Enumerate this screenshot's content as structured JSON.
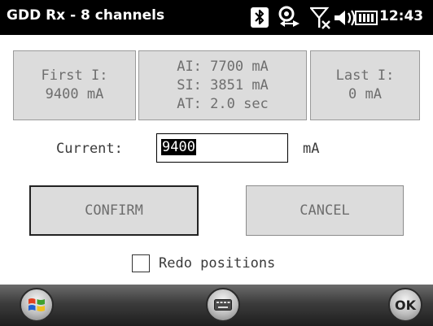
{
  "statusbar": {
    "title": "GDD Rx - 8 channels",
    "time": "12:43",
    "icons": [
      "bluetooth-icon",
      "network-sync-icon",
      "no-signal-icon",
      "volume-icon",
      "battery-icon"
    ]
  },
  "info": {
    "first_line1": "First I:",
    "first_line2": "9400 mA",
    "mid_line1": "AI: 7700 mA",
    "mid_line2": "SI: 3851 mA",
    "mid_line3": "AT: 2.0 sec",
    "last_line1": "Last I:",
    "last_line2": "0 mA"
  },
  "current": {
    "label": "Current:",
    "value": "9400",
    "unit": "mA"
  },
  "buttons": {
    "confirm": "CONFIRM",
    "cancel": "CANCEL"
  },
  "redo": {
    "label": "Redo positions",
    "checked": false
  },
  "bottombar": {
    "start_icon": "windows-start-icon",
    "keyboard_icon": "keyboard-icon",
    "ok_label": "OK"
  },
  "colors": {
    "statusbar_bg": "#000000",
    "panel_bg": "#dcdcdc",
    "text_gray": "#6e6e6e"
  }
}
